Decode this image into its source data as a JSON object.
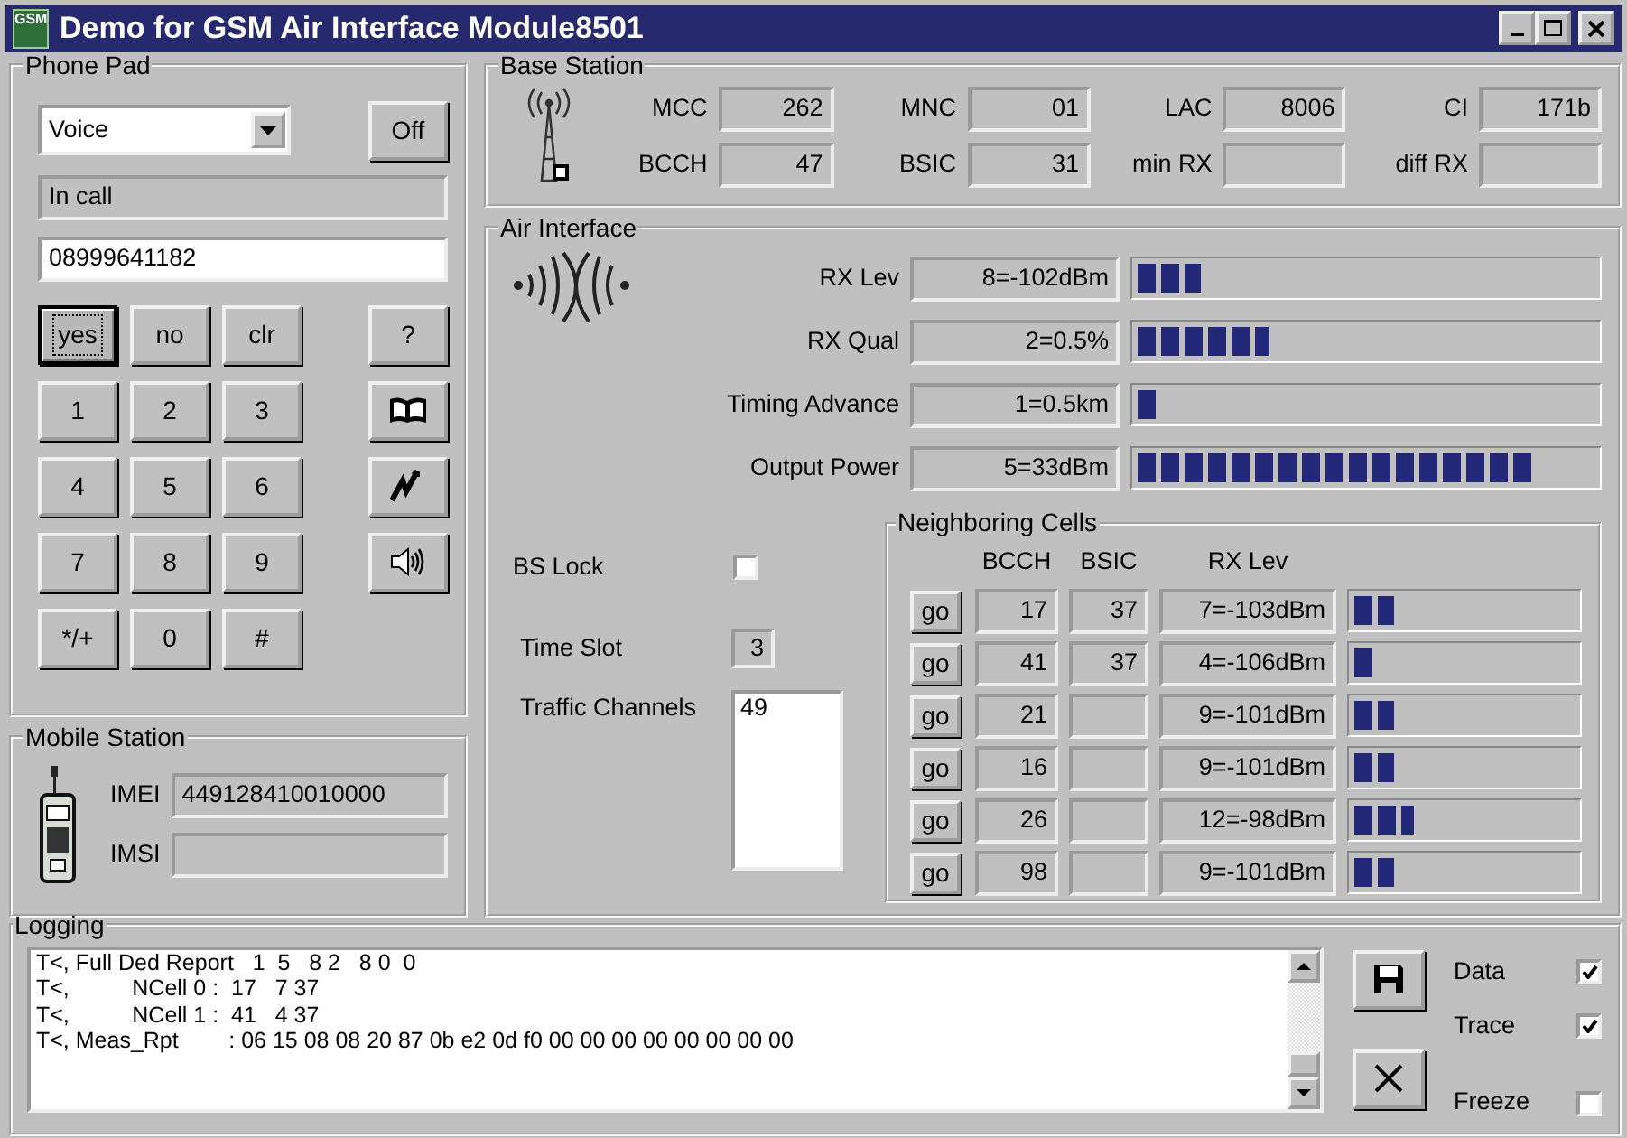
{
  "window": {
    "title": "Demo for GSM Air Interface Module8501",
    "icon_label": "GSM"
  },
  "phone_pad": {
    "title": "Phone Pad",
    "mode": "Voice",
    "power_button": "Off",
    "status": "In call",
    "number": "08999641182",
    "keys": [
      {
        "label": "yes",
        "focused": true
      },
      {
        "label": "no",
        "focused": false
      },
      {
        "label": "clr",
        "focused": false
      },
      {
        "label": "1",
        "focused": false
      },
      {
        "label": "2",
        "focused": false
      },
      {
        "label": "3",
        "focused": false
      },
      {
        "label": "4",
        "focused": false
      },
      {
        "label": "5",
        "focused": false
      },
      {
        "label": "6",
        "focused": false
      },
      {
        "label": "7",
        "focused": false
      },
      {
        "label": "8",
        "focused": false
      },
      {
        "label": "9",
        "focused": false
      },
      {
        "label": "*/+",
        "focused": false
      },
      {
        "label": "0",
        "focused": false
      },
      {
        "label": "#",
        "focused": false
      }
    ],
    "side_keys": [
      {
        "kind": "text",
        "label": "?"
      },
      {
        "kind": "book"
      },
      {
        "kind": "signal"
      },
      {
        "kind": "speaker"
      }
    ]
  },
  "mobile_station": {
    "title": "Mobile Station",
    "fields": [
      {
        "label": "IMEI",
        "value": "449128410010000"
      },
      {
        "label": "IMSI"
      }
    ]
  },
  "base_station": {
    "title": "Base Station",
    "fields": [
      {
        "label": "MCC",
        "value": "262"
      },
      {
        "label": "MNC",
        "value": "01"
      },
      {
        "label": "LAC",
        "value": "8006"
      },
      {
        "label": "CI",
        "value": "171b"
      },
      {
        "label": "BCCH",
        "value": "47"
      },
      {
        "label": "BSIC",
        "value": "31"
      },
      {
        "label": "min RX"
      },
      {
        "label": "diff RX"
      }
    ]
  },
  "air_interface": {
    "title": "Air Interface",
    "meters": [
      {
        "label": "RX Lev",
        "reading": "8=-102dBm",
        "level": 0.14
      },
      {
        "label": "RX Qual",
        "reading": "2=0.5%",
        "level": 0.29
      },
      {
        "label": "Timing Advance",
        "reading": "1=0.5km",
        "level": 0.05
      },
      {
        "label": "Output Power",
        "reading": "5=33dBm",
        "level": 0.86
      }
    ],
    "bs_lock": {
      "label": "BS Lock",
      "checked": false
    },
    "time_slot": {
      "label": "Time Slot",
      "value": "3"
    },
    "traffic_channels": {
      "label": "Traffic Channels",
      "items": [
        "49"
      ]
    },
    "neighboring_cells": {
      "title": "Neighboring Cells",
      "columns": [
        "BCCH",
        "BSIC",
        "RX Lev"
      ],
      "rows": [
        {
          "button": "go",
          "bcch": "17",
          "bsic": "37",
          "rx_lev": "7=-103dBm",
          "level": 0.18
        },
        {
          "button": "go",
          "bcch": "41",
          "bsic": "37",
          "rx_lev": "4=-106dBm",
          "level": 0.09
        },
        {
          "button": "go",
          "bcch": "21",
          "rx_lev": "9=-101dBm",
          "level": 0.18
        },
        {
          "button": "go",
          "bcch": "16",
          "rx_lev": "9=-101dBm",
          "level": 0.18
        },
        {
          "button": "go",
          "bcch": "26",
          "rx_lev": "12=-98dBm",
          "level": 0.27
        },
        {
          "button": "go",
          "bcch": "98",
          "rx_lev": "9=-101dBm",
          "level": 0.18
        }
      ]
    }
  },
  "logging": {
    "title": "Logging",
    "lines": [
      "T<, Full Ded Report   1  5   8 2   8 0  0",
      "T<,          NCell 0 :  17   7 37",
      "T<,          NCell 1 :  41   4 37",
      "T<, Meas_Rpt        : 06 15 08 08 20 87 0b e2 0d f0 00 00 00 00 00 00 00 00"
    ],
    "options": [
      {
        "label": "Data",
        "checked": true
      },
      {
        "label": "Trace",
        "checked": true
      },
      {
        "label": "Freeze",
        "checked": false
      }
    ]
  }
}
